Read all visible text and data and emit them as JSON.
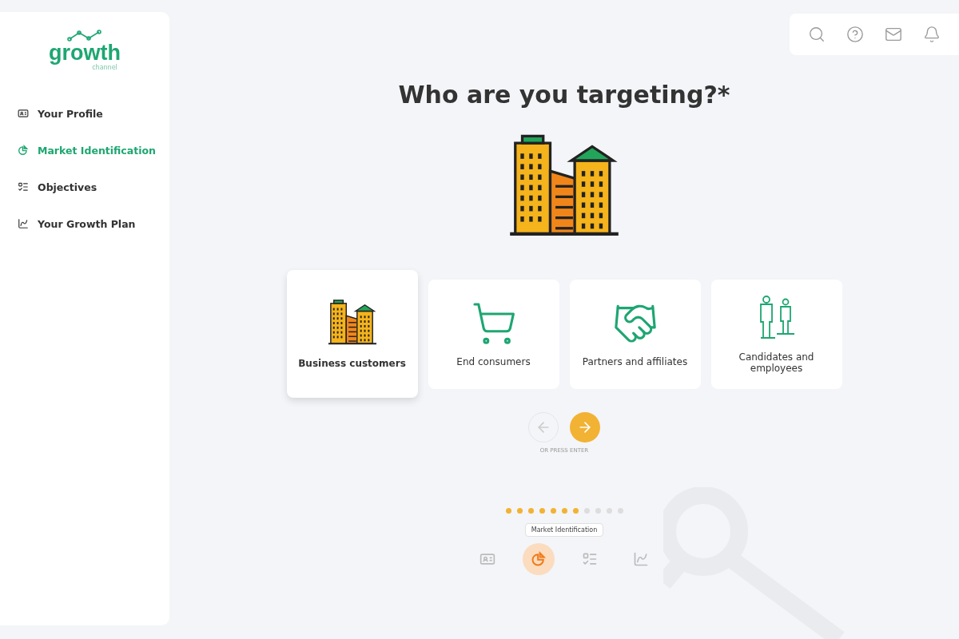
{
  "logo": {
    "word": "growth",
    "sub": "channel"
  },
  "sidebar": {
    "items": [
      {
        "label": "Your Profile",
        "kind": "profile",
        "selected": false
      },
      {
        "label": "Market Identification",
        "kind": "market",
        "selected": true
      },
      {
        "label": "Objectives",
        "kind": "objectives",
        "selected": false
      },
      {
        "label": "Your Growth Plan",
        "kind": "plan",
        "selected": false
      }
    ]
  },
  "header": {
    "icons": [
      {
        "kind": "search"
      },
      {
        "kind": "help"
      },
      {
        "kind": "mail"
      },
      {
        "kind": "bell"
      }
    ]
  },
  "question": "Who are you targeting?*",
  "options": [
    {
      "label": "Business customers",
      "kind": "buildings",
      "selected": true
    },
    {
      "label": "End consumers",
      "kind": "cart",
      "selected": false
    },
    {
      "label": "Partners and affiliates",
      "kind": "handshake",
      "selected": false
    },
    {
      "label": "Candidates and employees",
      "kind": "people",
      "selected": false
    }
  ],
  "nav": {
    "back_disabled": true,
    "hint": "OR PRESS ENTER"
  },
  "progress": [
    {
      "done": true
    },
    {
      "done": true
    },
    {
      "done": true
    },
    {
      "done": true
    },
    {
      "done": true
    },
    {
      "done": true
    },
    {
      "done": true
    },
    {
      "done": false
    },
    {
      "done": false
    },
    {
      "done": false
    },
    {
      "done": false
    }
  ],
  "steps": {
    "tooltip": "Market Identification",
    "items": [
      {
        "kind": "profile",
        "selected": false
      },
      {
        "kind": "market",
        "selected": true
      },
      {
        "kind": "objectives",
        "selected": false
      },
      {
        "kind": "plan",
        "selected": false
      }
    ]
  }
}
